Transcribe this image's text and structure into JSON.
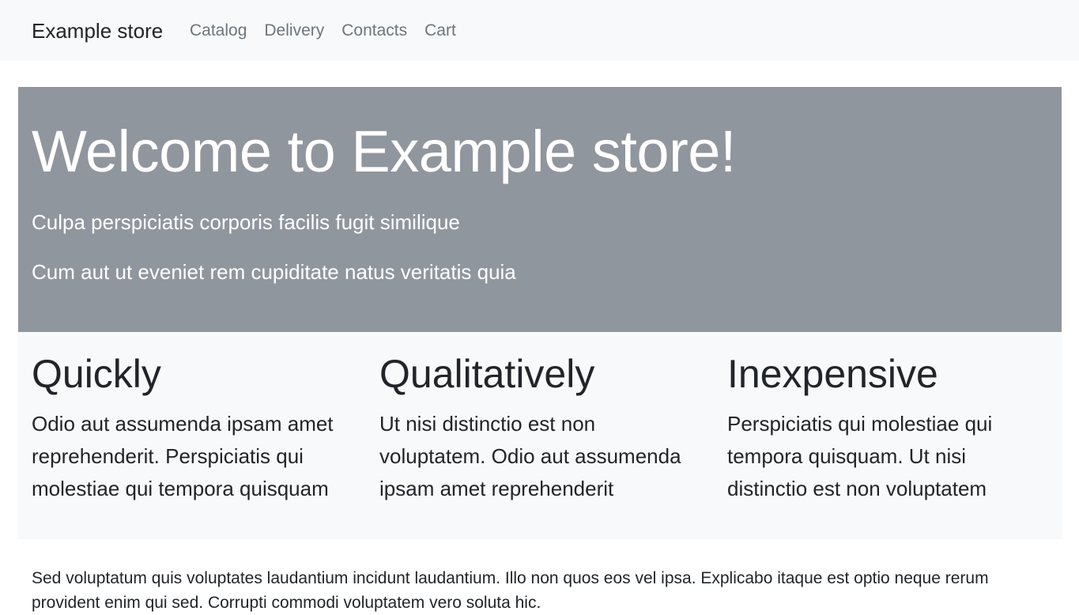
{
  "navbar": {
    "brand": "Example store",
    "links": [
      "Catalog",
      "Delivery",
      "Contacts",
      "Cart"
    ]
  },
  "hero": {
    "title": "Welcome to Example store!",
    "lines": [
      "Culpa perspiciatis corporis facilis fugit similique",
      "Cum aut ut eveniet rem cupiditate natus veritatis quia"
    ]
  },
  "features": [
    {
      "title": "Quickly",
      "text": "Odio aut assumenda ipsam amet reprehenderit. Perspiciatis qui molestiae qui tempora quisquam"
    },
    {
      "title": "Qualitatively",
      "text": "Ut nisi distinctio est non voluptatem. Odio aut assumenda ipsam amet reprehenderit"
    },
    {
      "title": "Inexpensive",
      "text": "Perspiciatis qui molestiae qui tempora quisquam. Ut nisi distinctio est non voluptatem"
    }
  ],
  "footer": {
    "text": "Sed voluptatum quis voluptates laudantium incidunt laudantium. Illo non quos eos vel ipsa. Explicabo itaque est optio neque rerum provident enim qui sed. Corrupti commodi voluptatem vero soluta hic."
  },
  "colors": {
    "navbar_bg": "#f8f9fa",
    "hero_bg": "#90969d",
    "text": "#212529",
    "nav_link": "#6c757d"
  }
}
